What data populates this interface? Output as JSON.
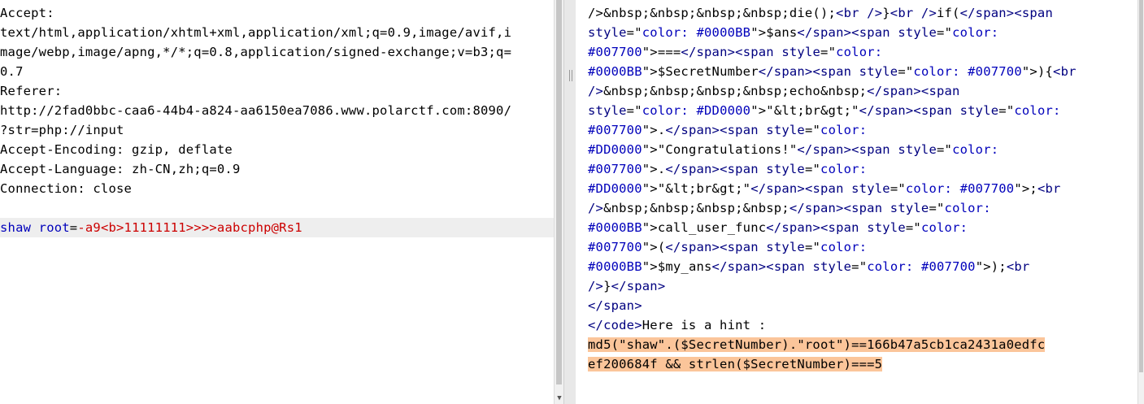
{
  "request": {
    "lines": [
      "Accept:",
      "text/html,application/xhtml+xml,application/xml;q=0.9,image/avif,i",
      "mage/webp,image/apng,*/*;q=0.8,application/signed-exchange;v=b3;q=",
      "0.7",
      "Referer:",
      "http://2fad0bbc-caa6-44b4-a824-aa6150ea7086.www.polarctf.com:8090/",
      "?str=php://input",
      "Accept-Encoding: gzip, deflate",
      "Accept-Language: zh-CN,zh;q=0.9",
      "Connection: close",
      ""
    ],
    "body": {
      "name": "shaw root",
      "eq": "=",
      "value": "-a9<b>11111111>>>>aabcphp@Rs1"
    }
  },
  "response": {
    "lines": [
      [
        {
          "t": "/>&nbsp;&nbsp;&nbsp;&nbsp;die();",
          "c": "txt"
        },
        {
          "t": "<br />",
          "c": "tag"
        },
        {
          "t": "}",
          "c": "txt"
        },
        {
          "t": "<br />",
          "c": "tag"
        },
        {
          "t": "if(",
          "c": "txt"
        },
        {
          "t": "</span>",
          "c": "tag"
        },
        {
          "t": "<span",
          "c": "tag"
        }
      ],
      [
        {
          "t": "style",
          "c": "sattr"
        },
        {
          "t": "=\"",
          "c": "txt"
        },
        {
          "t": "color: #0000BB",
          "c": "sval"
        },
        {
          "t": "\">",
          "c": "txt"
        },
        {
          "t": "$ans",
          "c": "txt"
        },
        {
          "t": "</span>",
          "c": "tag"
        },
        {
          "t": "<span ",
          "c": "tag"
        },
        {
          "t": "style",
          "c": "sattr"
        },
        {
          "t": "=\"",
          "c": "txt"
        },
        {
          "t": "color:",
          "c": "sval"
        }
      ],
      [
        {
          "t": "#007700",
          "c": "sval"
        },
        {
          "t": "\">",
          "c": "txt"
        },
        {
          "t": "===",
          "c": "txt"
        },
        {
          "t": "</span>",
          "c": "tag"
        },
        {
          "t": "<span ",
          "c": "tag"
        },
        {
          "t": "style",
          "c": "sattr"
        },
        {
          "t": "=\"",
          "c": "txt"
        },
        {
          "t": "color:",
          "c": "sval"
        }
      ],
      [
        {
          "t": "#0000BB",
          "c": "sval"
        },
        {
          "t": "\">",
          "c": "txt"
        },
        {
          "t": "$SecretNumber",
          "c": "txt"
        },
        {
          "t": "</span>",
          "c": "tag"
        },
        {
          "t": "<span ",
          "c": "tag"
        },
        {
          "t": "style",
          "c": "sattr"
        },
        {
          "t": "=\"",
          "c": "txt"
        },
        {
          "t": "color: #007700",
          "c": "sval"
        },
        {
          "t": "\">",
          "c": "txt"
        },
        {
          "t": "){",
          "c": "txt"
        },
        {
          "t": "<br",
          "c": "tag"
        }
      ],
      [
        {
          "t": "/>",
          "c": "tag"
        },
        {
          "t": "&nbsp;&nbsp;&nbsp;&nbsp;echo&nbsp;",
          "c": "txt"
        },
        {
          "t": "</span>",
          "c": "tag"
        },
        {
          "t": "<span",
          "c": "tag"
        }
      ],
      [
        {
          "t": "style",
          "c": "sattr"
        },
        {
          "t": "=\"",
          "c": "txt"
        },
        {
          "t": "color: #DD0000",
          "c": "sval"
        },
        {
          "t": "\">",
          "c": "txt"
        },
        {
          "t": "\"&lt;br&gt;\"",
          "c": "txt"
        },
        {
          "t": "</span>",
          "c": "tag"
        },
        {
          "t": "<span ",
          "c": "tag"
        },
        {
          "t": "style",
          "c": "sattr"
        },
        {
          "t": "=\"",
          "c": "txt"
        },
        {
          "t": "color:",
          "c": "sval"
        }
      ],
      [
        {
          "t": "#007700",
          "c": "sval"
        },
        {
          "t": "\">",
          "c": "txt"
        },
        {
          "t": ".",
          "c": "txt"
        },
        {
          "t": "</span>",
          "c": "tag"
        },
        {
          "t": "<span ",
          "c": "tag"
        },
        {
          "t": "style",
          "c": "sattr"
        },
        {
          "t": "=\"",
          "c": "txt"
        },
        {
          "t": "color:",
          "c": "sval"
        }
      ],
      [
        {
          "t": "#DD0000",
          "c": "sval"
        },
        {
          "t": "\">",
          "c": "txt"
        },
        {
          "t": "\"Congratulations!\"",
          "c": "txt"
        },
        {
          "t": "</span>",
          "c": "tag"
        },
        {
          "t": "<span ",
          "c": "tag"
        },
        {
          "t": "style",
          "c": "sattr"
        },
        {
          "t": "=\"",
          "c": "txt"
        },
        {
          "t": "color:",
          "c": "sval"
        }
      ],
      [
        {
          "t": "#007700",
          "c": "sval"
        },
        {
          "t": "\">",
          "c": "txt"
        },
        {
          "t": ".",
          "c": "txt"
        },
        {
          "t": "</span>",
          "c": "tag"
        },
        {
          "t": "<span ",
          "c": "tag"
        },
        {
          "t": "style",
          "c": "sattr"
        },
        {
          "t": "=\"",
          "c": "txt"
        },
        {
          "t": "color:",
          "c": "sval"
        }
      ],
      [
        {
          "t": "#DD0000",
          "c": "sval"
        },
        {
          "t": "\">",
          "c": "txt"
        },
        {
          "t": "\"&lt;br&gt;\"",
          "c": "txt"
        },
        {
          "t": "</span>",
          "c": "tag"
        },
        {
          "t": "<span ",
          "c": "tag"
        },
        {
          "t": "style",
          "c": "sattr"
        },
        {
          "t": "=\"",
          "c": "txt"
        },
        {
          "t": "color: #007700",
          "c": "sval"
        },
        {
          "t": "\">",
          "c": "txt"
        },
        {
          "t": ";",
          "c": "txt"
        },
        {
          "t": "<br",
          "c": "tag"
        }
      ],
      [
        {
          "t": "/>",
          "c": "tag"
        },
        {
          "t": "&nbsp;&nbsp;&nbsp;&nbsp;",
          "c": "txt"
        },
        {
          "t": "</span>",
          "c": "tag"
        },
        {
          "t": "<span ",
          "c": "tag"
        },
        {
          "t": "style",
          "c": "sattr"
        },
        {
          "t": "=\"",
          "c": "txt"
        },
        {
          "t": "color:",
          "c": "sval"
        }
      ],
      [
        {
          "t": "#0000BB",
          "c": "sval"
        },
        {
          "t": "\">",
          "c": "txt"
        },
        {
          "t": "call_user_func",
          "c": "txt"
        },
        {
          "t": "</span>",
          "c": "tag"
        },
        {
          "t": "<span ",
          "c": "tag"
        },
        {
          "t": "style",
          "c": "sattr"
        },
        {
          "t": "=\"",
          "c": "txt"
        },
        {
          "t": "color:",
          "c": "sval"
        }
      ],
      [
        {
          "t": "#007700",
          "c": "sval"
        },
        {
          "t": "\">",
          "c": "txt"
        },
        {
          "t": "(",
          "c": "txt"
        },
        {
          "t": "</span>",
          "c": "tag"
        },
        {
          "t": "<span ",
          "c": "tag"
        },
        {
          "t": "style",
          "c": "sattr"
        },
        {
          "t": "=\"",
          "c": "txt"
        },
        {
          "t": "color:",
          "c": "sval"
        }
      ],
      [
        {
          "t": "#0000BB",
          "c": "sval"
        },
        {
          "t": "\">",
          "c": "txt"
        },
        {
          "t": "$my_ans",
          "c": "txt"
        },
        {
          "t": "</span>",
          "c": "tag"
        },
        {
          "t": "<span ",
          "c": "tag"
        },
        {
          "t": "style",
          "c": "sattr"
        },
        {
          "t": "=\"",
          "c": "txt"
        },
        {
          "t": "color: #007700",
          "c": "sval"
        },
        {
          "t": "\">",
          "c": "txt"
        },
        {
          "t": ");",
          "c": "txt"
        },
        {
          "t": "<br",
          "c": "tag"
        }
      ],
      [
        {
          "t": "/>",
          "c": "tag"
        },
        {
          "t": "}",
          "c": "txt"
        },
        {
          "t": "</span>",
          "c": "tag"
        }
      ],
      [
        {
          "t": "</span>",
          "c": "tag"
        }
      ],
      [
        {
          "t": "</code>",
          "c": "tag"
        },
        {
          "t": "Here is a hint :",
          "c": "txt"
        }
      ],
      [
        {
          "t": "md5(\"shaw\".($SecretNumber).\"root\")==166b47a5cb1ca2431a0edfc",
          "c": "hl"
        }
      ],
      [
        {
          "t": "ef200684f && strlen($SecretNumber)===5",
          "c": "hl"
        }
      ]
    ]
  }
}
